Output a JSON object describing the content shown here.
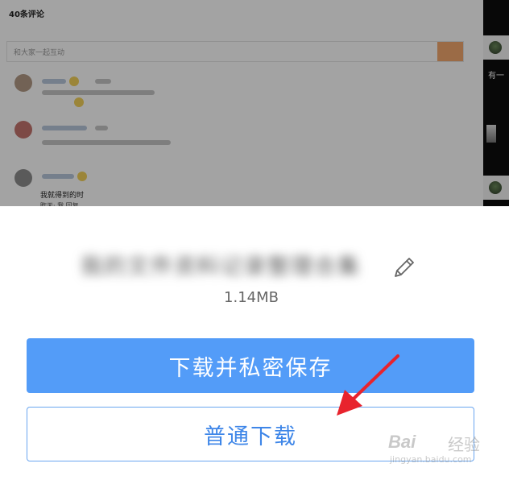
{
  "background": {
    "comments_title": "40条评论",
    "comment_placeholder": "和大家一起互动",
    "partial_comment_text": "我就得到的时",
    "partial_comment_meta": "昨天· 我 回复",
    "side_caption": "有一"
  },
  "sheet": {
    "file_name": "我的文件资料记录整理合集",
    "file_size": "1.14MB",
    "private_button_label": "下载并私密保存",
    "normal_button_label": "普通下载"
  },
  "watermark": {
    "brand": "Bai",
    "brand_cn": "经验",
    "url": "jingyan.baidu.com"
  },
  "colors": {
    "primary_button": "#539cf8",
    "outline_button_text": "#3e86e8",
    "annotation_arrow": "#e8232d",
    "overlay": "rgba(0,0,0,0.36)"
  },
  "icons": [
    "pencil-icon",
    "annotation-arrow-icon"
  ]
}
